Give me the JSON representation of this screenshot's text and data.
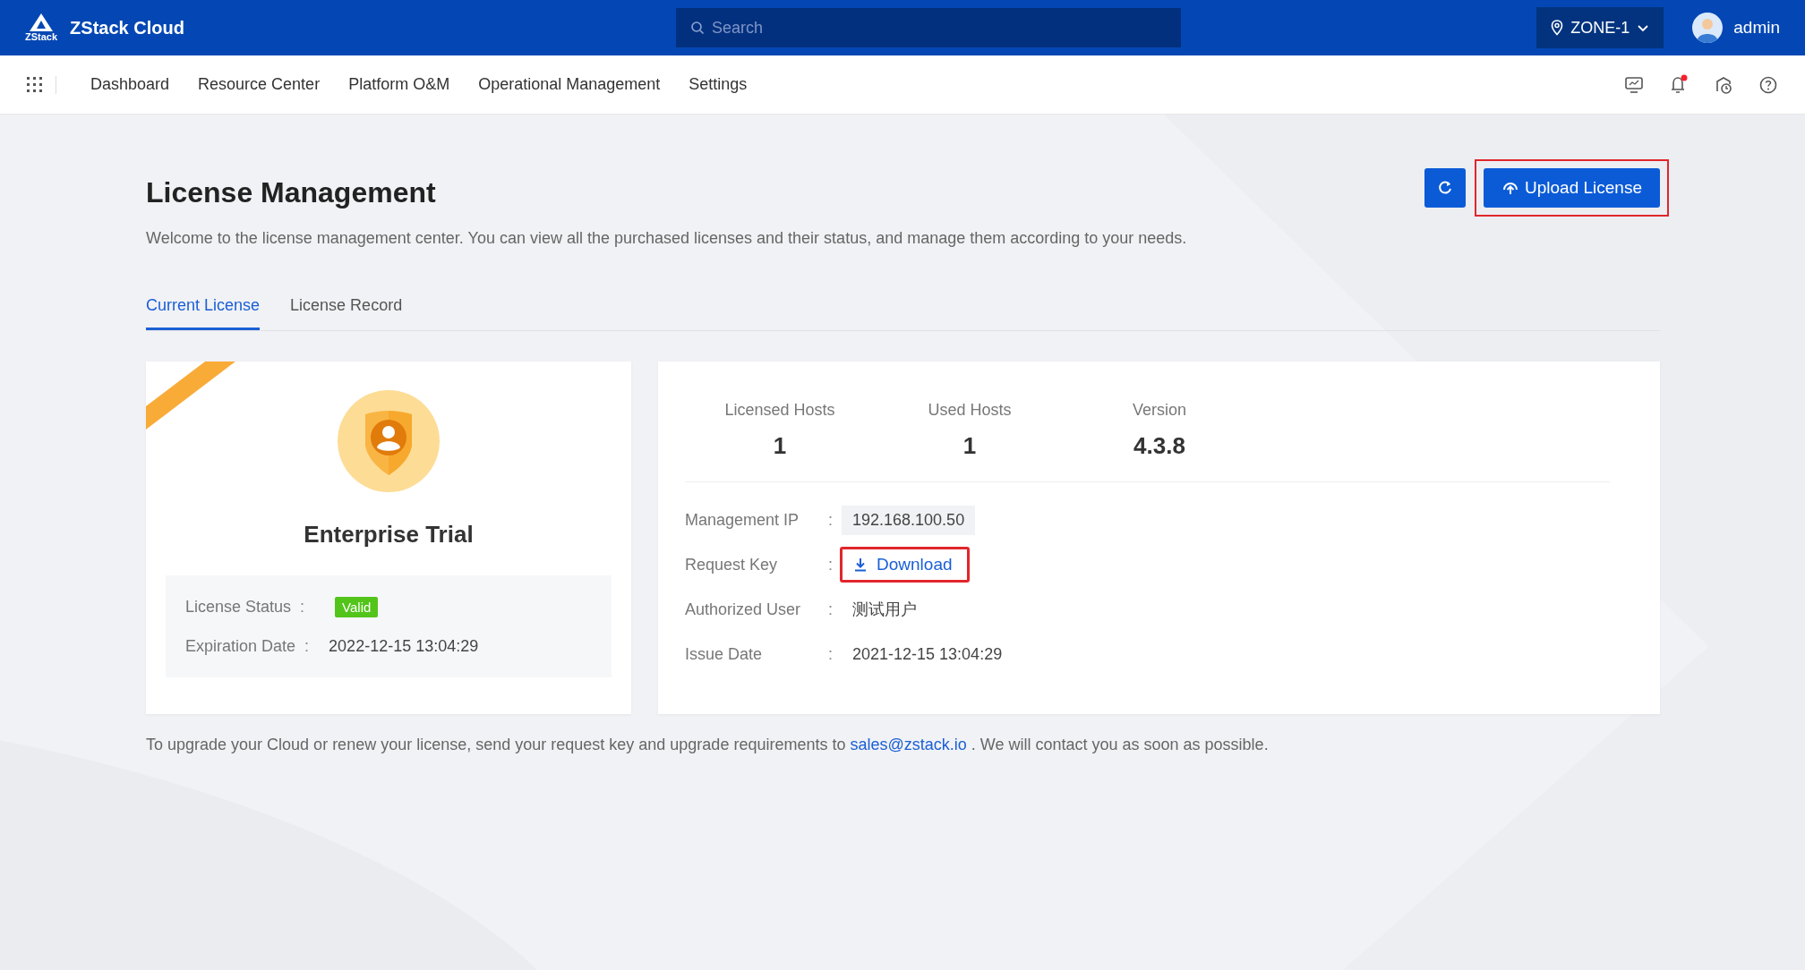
{
  "topbar": {
    "brand": "ZStack Cloud",
    "logo_text": "ZStack",
    "search": {
      "placeholder": "Search"
    },
    "zone": "ZONE-1",
    "user": "admin"
  },
  "nav": {
    "items": [
      {
        "label": "Dashboard",
        "selected": false
      },
      {
        "label": "Resource Center",
        "selected": false
      },
      {
        "label": "Platform O&M",
        "selected": false
      },
      {
        "label": "Operational Management",
        "selected": false
      },
      {
        "label": "Settings",
        "selected": false
      }
    ],
    "notification_dot": true
  },
  "page": {
    "title": "License Management",
    "description": "Welcome to the license management center. You can view all the purchased licenses and their status, and manage them according to your needs.",
    "upload_button": {
      "label": "Upload License",
      "highlighted": true
    }
  },
  "tabs": [
    {
      "label": "Current License",
      "selected": true
    },
    {
      "label": "License Record",
      "selected": false
    }
  ],
  "license_card": {
    "edition": "Enterprise Trial",
    "fields": [
      {
        "label": "License Status",
        "separator": ":",
        "kind": "badge",
        "value": "Valid",
        "color": "#52c41a"
      },
      {
        "label": "Expiration Date",
        "separator": ":",
        "kind": "text",
        "value": "2022-12-15 13:04:29"
      }
    ]
  },
  "details_card": {
    "stats": [
      {
        "label": "Licensed Hosts",
        "value": "1"
      },
      {
        "label": "Used Hosts",
        "value": "1"
      },
      {
        "label": "Version",
        "value": "4.3.8"
      }
    ],
    "fields": [
      {
        "label": "Management IP",
        "separator": ":",
        "kind": "chip",
        "value": "192.168.100.50"
      },
      {
        "label": "Request Key",
        "separator": ":",
        "kind": "download",
        "value": "Download",
        "highlighted": true
      },
      {
        "label": "Authorized User",
        "separator": ":",
        "kind": "text",
        "value": "测试用户"
      },
      {
        "label": "Issue Date",
        "separator": ":",
        "kind": "text",
        "value": "2021-12-15 13:04:29"
      }
    ]
  },
  "footer": {
    "before": "To upgrade your Cloud or renew your license, send your request key and upgrade requirements to",
    "link": "sales@zstack.io",
    "after": ". We will contact you as soon as possible."
  }
}
